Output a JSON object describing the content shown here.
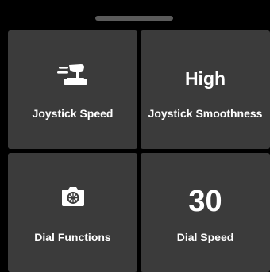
{
  "sheet": {
    "colors": {
      "background": "#000000",
      "tile": "#3b3b3b",
      "text": "#ffffff",
      "handle": "#5a5a5a"
    }
  },
  "tiles": [
    {
      "label": "Joystick Speed",
      "icon": "joystick-speed-icon"
    },
    {
      "label": "Joystick Smoothness",
      "value": "High"
    },
    {
      "label": "Dial Functions",
      "icon": "camera-icon"
    },
    {
      "label": "Dial Speed",
      "value": "30"
    }
  ]
}
